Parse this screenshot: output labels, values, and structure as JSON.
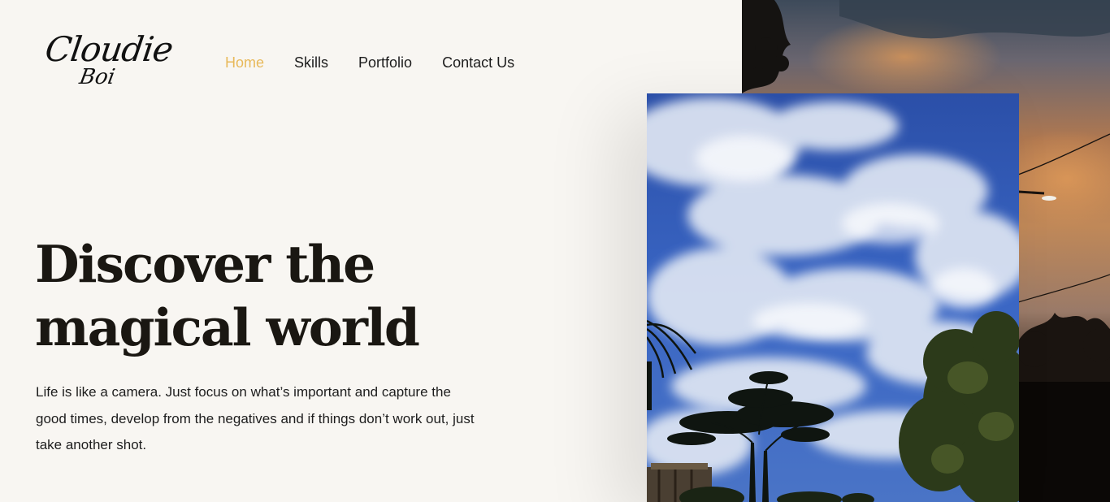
{
  "header": {
    "logo": {
      "line1": "Cloudie",
      "line2": "Boi"
    },
    "nav": [
      {
        "label": "Home",
        "active": true
      },
      {
        "label": "Skills",
        "active": false
      },
      {
        "label": "Portfolio",
        "active": false
      },
      {
        "label": "Contact Us",
        "active": false
      }
    ]
  },
  "hero": {
    "title_line1": "Discover the",
    "title_line2": "magical world",
    "description": "Life is like a camera. Just focus on what’s important and capture the good times, develop from the negatives and if things don’t work out,  just take another shot."
  },
  "colors": {
    "background": "#f8f6f2",
    "accent": "#e8b95a",
    "text": "#1a1712"
  }
}
